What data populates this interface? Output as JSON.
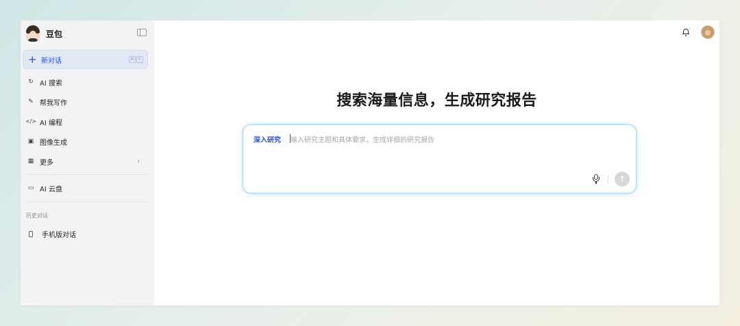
{
  "sidebar": {
    "brand_name": "豆包",
    "new_chat": {
      "label": "新对话",
      "shortcut_keys": [
        "⌘",
        "K"
      ]
    },
    "items": [
      {
        "label": "AI 搜索",
        "icon": "search-refresh-icon"
      },
      {
        "label": "帮我写作",
        "icon": "pen-icon"
      },
      {
        "label": "AI 编程",
        "icon": "code-icon"
      },
      {
        "label": "图像生成",
        "icon": "image-icon"
      },
      {
        "label": "更多",
        "icon": "grid-icon"
      }
    ],
    "cloud_drive": {
      "label": "AI 云盘",
      "icon": "folder-icon"
    },
    "history_label": "历史对话",
    "history": [
      {
        "label": "手机版对话",
        "icon": "phone-icon"
      }
    ]
  },
  "main": {
    "headline": "搜索海量信息，生成研究报告",
    "input": {
      "mode": "深入研究",
      "placeholder": "输入研究主题和具体要求，生成详细的研究报告"
    }
  },
  "colors": {
    "accent": "#2250d8",
    "sidebar_bg": "#f3f3f5",
    "input_border": "#a9d6f2"
  }
}
